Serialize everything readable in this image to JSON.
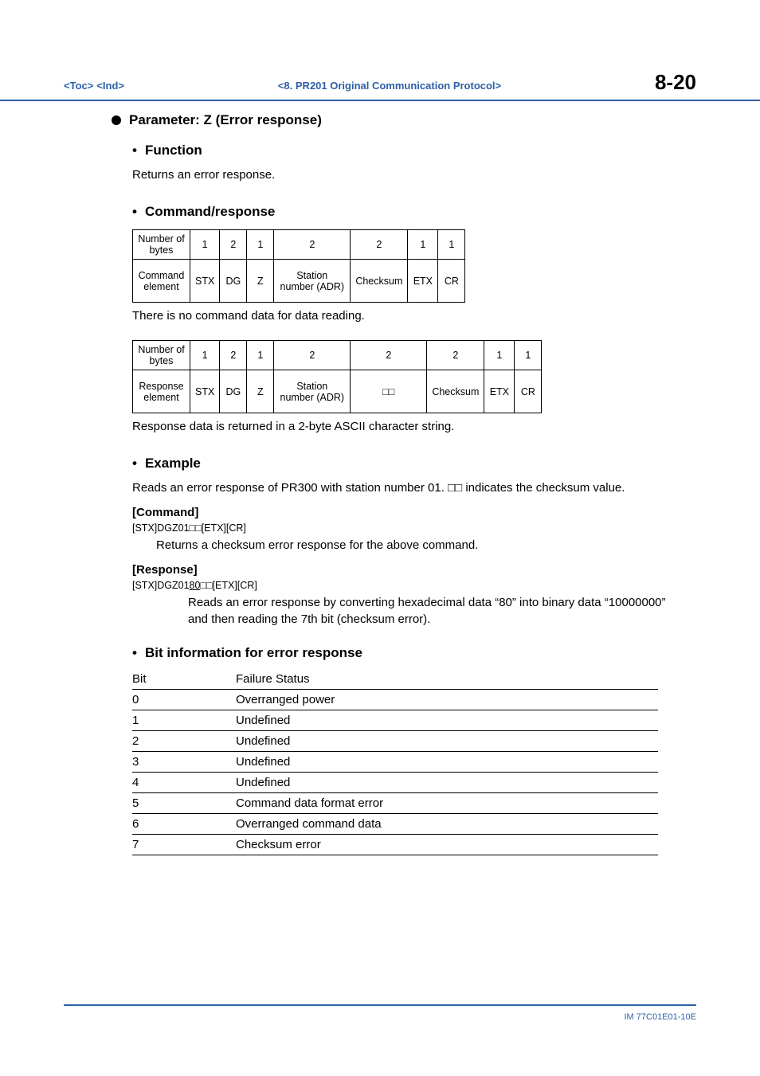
{
  "header": {
    "toc": "<Toc>",
    "ind": "<Ind>",
    "chapter": "<8.  PR201 Original Communication Protocol>",
    "page": "8-20"
  },
  "param_title": "Parameter: Z (Error response)",
  "function": {
    "heading": "Function",
    "text": "Returns an error response."
  },
  "cmdresp": {
    "heading": "Command/response",
    "cmd_table": {
      "row1": [
        "Number of bytes",
        "1",
        "2",
        "1",
        "2",
        "2",
        "1",
        "1"
      ],
      "row2": [
        "Command element",
        "STX",
        "DG",
        "Z",
        "Station number (ADR)",
        "Checksum",
        "ETX",
        "CR"
      ]
    },
    "cmd_note": "There is no command data for data reading.",
    "resp_table": {
      "row1": [
        "Number of bytes",
        "1",
        "2",
        "1",
        "2",
        "2",
        "2",
        "1",
        "1"
      ],
      "row2": [
        "Response element",
        "STX",
        "DG",
        "Z",
        "Station number (ADR)",
        "□□",
        "Checksum",
        "ETX",
        "CR"
      ]
    },
    "resp_note": "Response data is returned in a 2-byte ASCII character string."
  },
  "example": {
    "heading": "Example",
    "intro": "Reads an error response of PR300 with station number 01. □□ indicates the checksum value.",
    "cmd_label": "[Command]",
    "cmd_line": "[STX]DGZ01□□[ETX][CR]",
    "cmd_desc": "Returns a checksum error response for the above command.",
    "resp_label": "[Response]",
    "resp_line_pre": "[STX]DGZ01",
    "resp_line_u": "80",
    "resp_line_post": "□□[ETX][CR]",
    "resp_desc": "Reads an error response by converting hexadecimal data “80” into binary data “10000000” and then reading the 7th bit (checksum error)."
  },
  "bitinfo": {
    "heading": "Bit information for error response",
    "header": [
      "Bit",
      "Failure Status"
    ],
    "rows": [
      [
        "0",
        "Overranged power"
      ],
      [
        "1",
        "Undefined"
      ],
      [
        "2",
        "Undefined"
      ],
      [
        "3",
        "Undefined"
      ],
      [
        "4",
        "Undefined"
      ],
      [
        "5",
        "Command data format error"
      ],
      [
        "6",
        "Overranged command data"
      ],
      [
        "7",
        "Checksum error"
      ]
    ]
  },
  "footer": "IM 77C01E01-10E"
}
